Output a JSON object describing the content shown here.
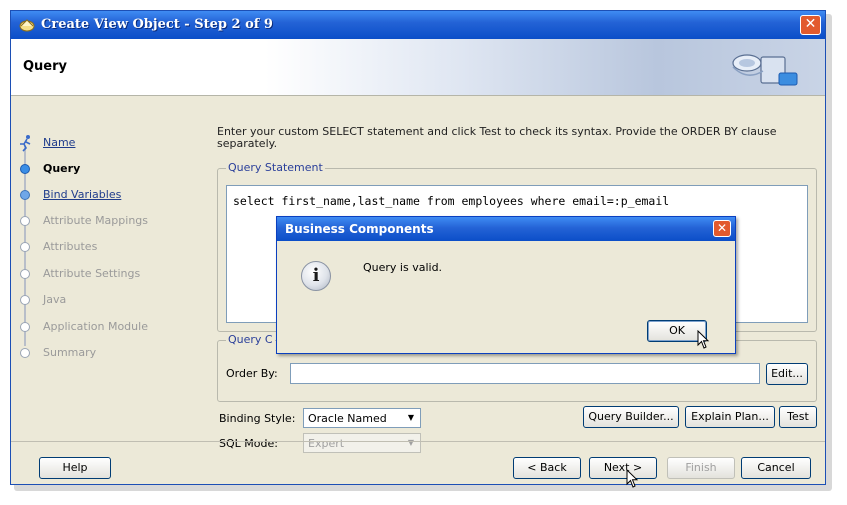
{
  "window": {
    "title": "Create View Object - Step 2 of 9",
    "close_label": "✕"
  },
  "header": {
    "title": "Query"
  },
  "nav": {
    "items": [
      {
        "label": "Name",
        "state": "link"
      },
      {
        "label": "Query",
        "state": "current"
      },
      {
        "label": "Bind Variables",
        "state": "link"
      },
      {
        "label": "Attribute Mappings",
        "state": "disabled"
      },
      {
        "label": "Attributes",
        "state": "disabled"
      },
      {
        "label": "Attribute Settings",
        "state": "disabled"
      },
      {
        "label": "Java",
        "state": "disabled"
      },
      {
        "label": "Application Module",
        "state": "disabled"
      },
      {
        "label": "Summary",
        "state": "disabled"
      }
    ]
  },
  "content": {
    "instructions": "Enter your custom SELECT statement and click Test to check its syntax.  Provide the ORDER BY clause separately.",
    "query_statement_legend": "Query Statement",
    "query_text": "select first_name,last_name from employees where email=:p_email",
    "query_clauses_legend": "Query C",
    "order_by_label": "Order By:",
    "order_by_value": "",
    "edit_button": "Edit...",
    "binding_style_label": "Binding Style:",
    "binding_style_value": "Oracle Named",
    "sql_mode_label": "SQL Mode:",
    "sql_mode_value": "Expert",
    "query_builder_button": "Query Builder...",
    "explain_plan_button": "Explain Plan...",
    "test_button": "Test"
  },
  "footer": {
    "help_button": "Help",
    "back_button": "< Back",
    "next_button": "Next >",
    "finish_button": "Finish",
    "cancel_button": "Cancel"
  },
  "dialog": {
    "title": "Business Components",
    "close_label": "✕",
    "message": "Query is valid.",
    "icon_glyph": "i",
    "ok_button": "OK"
  },
  "colors": {
    "titlebar": "#0b4ec8",
    "accent": "#2463d6",
    "link": "#1f3c8c"
  }
}
